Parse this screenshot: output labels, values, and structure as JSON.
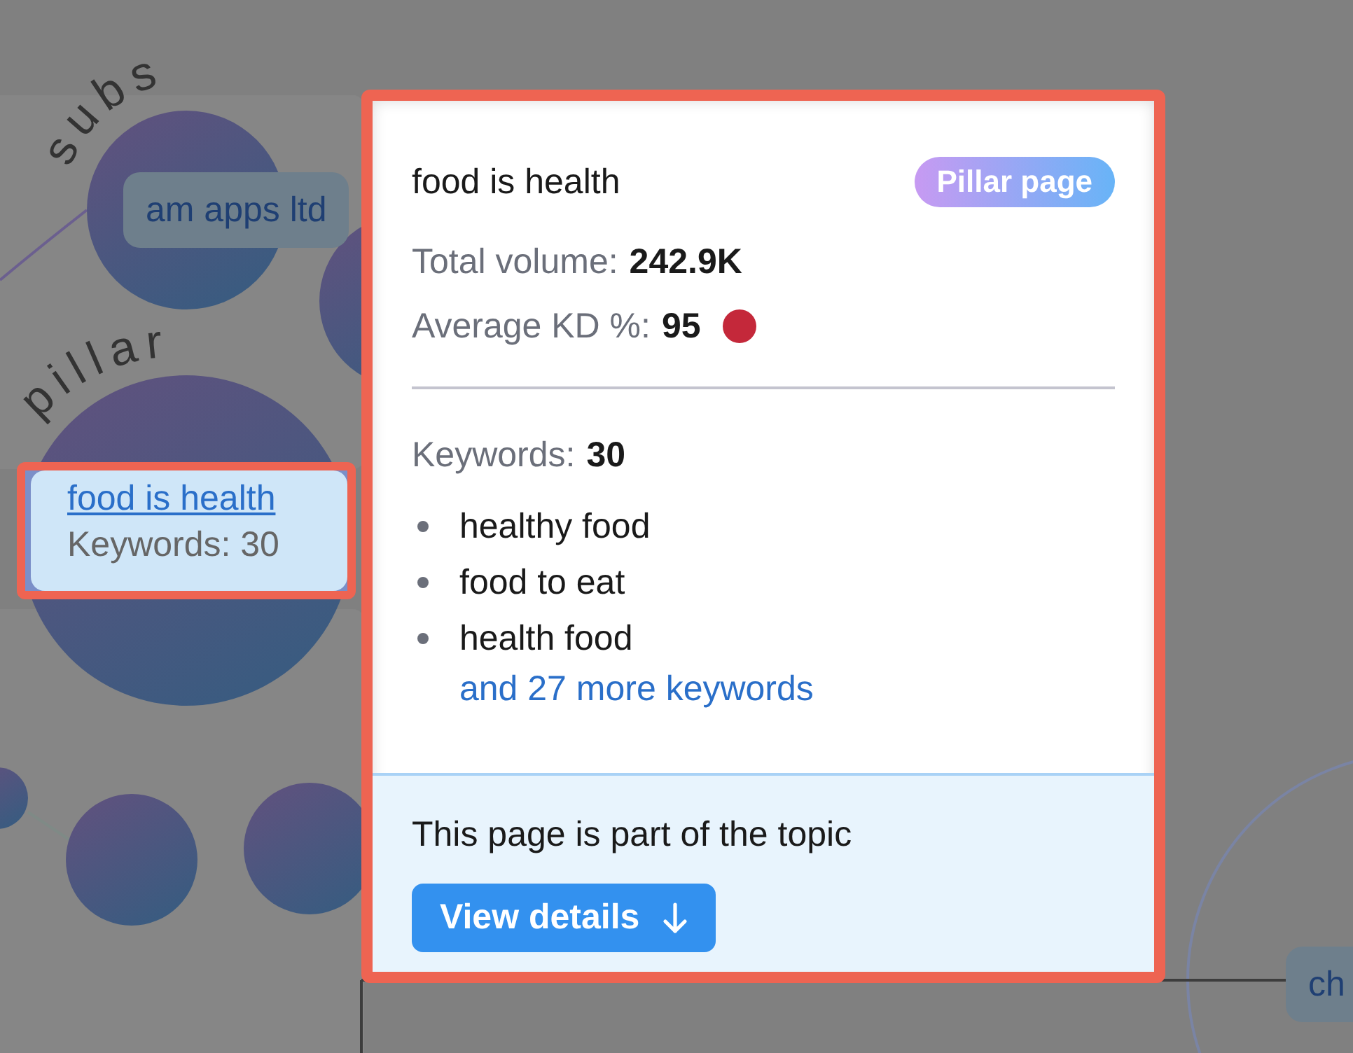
{
  "canvas": {
    "topic_labels": [
      "subs",
      "pillar"
    ],
    "chips": [
      "am apps ltd",
      "ch"
    ],
    "node": {
      "title": "food is health",
      "keywords": "Keywords: 30"
    }
  },
  "popup": {
    "title": "food is health",
    "badge": "Pillar page",
    "stats": [
      {
        "label": "Total volume:",
        "value": "242.9K"
      },
      {
        "label": "Average KD %:",
        "value": "95",
        "color": "#c4283a"
      }
    ],
    "keywords_label": "Keywords:",
    "keywords_count": "30",
    "keywords": [
      "healthy food",
      "food to eat",
      "health food"
    ],
    "more_link": "and 27 more keywords",
    "footer_text": "This page is part of the topic",
    "button": {
      "label": "View details"
    }
  }
}
